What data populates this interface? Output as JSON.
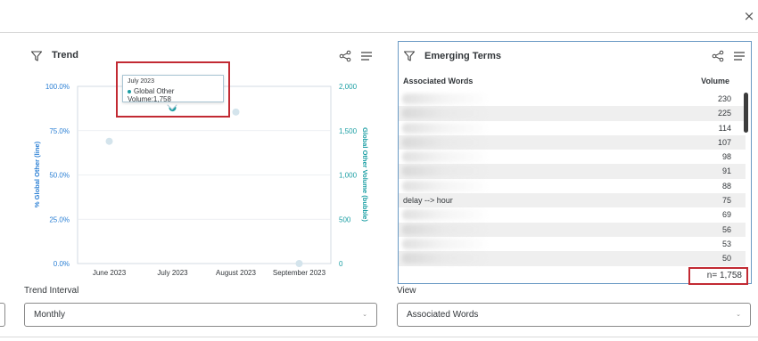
{
  "dialog": {
    "close_glyph": "×"
  },
  "trend": {
    "title": "Trend",
    "icons": {
      "filter": "filter-icon",
      "share": "share-icon",
      "menu": "menu-icon"
    },
    "tooltip": {
      "title": "July 2023",
      "series": "Global Other Volume",
      "value": "1,758",
      "text": "Global Other Volume:1,758"
    }
  },
  "chart_data": {
    "type": "scatter",
    "categories": [
      "June 2023",
      "July 2023",
      "August 2023",
      "September 2023"
    ],
    "series": [
      {
        "name": "Global Other Volume",
        "axis": "right",
        "values": [
          1380,
          1758,
          1710,
          0
        ],
        "highlight_index": 1
      }
    ],
    "left_axis": {
      "label": "% Global Other (line)",
      "ticks": [
        "100.0%",
        "75.0%",
        "50.0%",
        "25.0%",
        "0.0%"
      ],
      "range": [
        0,
        100
      ]
    },
    "right_axis": {
      "label": "Global Other Volume (bubble)",
      "ticks": [
        "2,000",
        "1,500",
        "1,000",
        "500",
        "0"
      ],
      "range": [
        0,
        2000
      ]
    },
    "colors": {
      "left_axis": "#2a7fd4",
      "right_axis": "#1a9ea3",
      "point": "#d4e4ec",
      "highlight": "#1a9ea3"
    }
  },
  "terms": {
    "title": "Emerging Terms",
    "icons": {
      "filter": "filter-icon",
      "share": "share-icon",
      "menu": "menu-icon"
    },
    "col_words": "Associated Words",
    "col_volume": "Volume",
    "rows": [
      {
        "word": "",
        "volume": "230",
        "blurred": true
      },
      {
        "word": "",
        "volume": "225",
        "blurred": true
      },
      {
        "word": "",
        "volume": "114",
        "blurred": true
      },
      {
        "word": "",
        "volume": "107",
        "blurred": true
      },
      {
        "word": "",
        "volume": "98",
        "blurred": true
      },
      {
        "word": "",
        "volume": "91",
        "blurred": true
      },
      {
        "word": "",
        "volume": "88",
        "blurred": true
      },
      {
        "word": "delay --> hour",
        "volume": "75",
        "blurred": false
      },
      {
        "word": "",
        "volume": "69",
        "blurred": true
      },
      {
        "word": "",
        "volume": "56",
        "blurred": true
      },
      {
        "word": "",
        "volume": "53",
        "blurred": true
      },
      {
        "word": "",
        "volume": "50",
        "blurred": true
      }
    ],
    "n_count": "n= 1,758"
  },
  "controls": {
    "trend_interval": {
      "label": "Trend Interval",
      "value": "Monthly"
    },
    "view": {
      "label": "View",
      "value": "Associated Words"
    },
    "caret_glyph": "⌄"
  },
  "highlight_color": "#c22a33"
}
